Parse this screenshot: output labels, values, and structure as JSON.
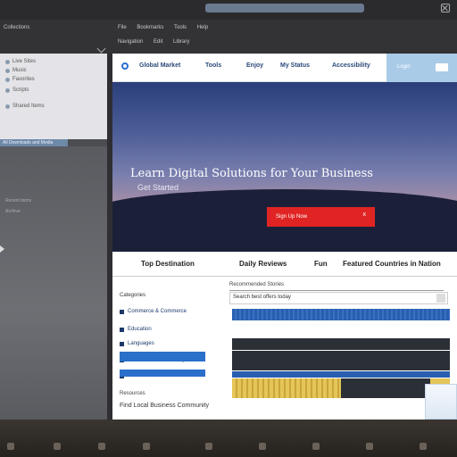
{
  "topbar": {
    "search_label": ""
  },
  "menubar": {
    "row1": [
      "File",
      "Bookmarks",
      "Tools",
      "Help"
    ],
    "row2": [
      "Navigation",
      "Edit",
      "Library"
    ],
    "left_title": "Collections"
  },
  "sidebar": {
    "items": [
      "Live Sites",
      "Music",
      "Favorites",
      "Scripts",
      "Shared Items"
    ],
    "selected": "All Downloads and Media",
    "lower_items": [
      "Recent items",
      "Archive"
    ]
  },
  "nav": {
    "links": [
      "Global Market",
      "Tools",
      "Enjoy",
      "My Status",
      "Accessibility"
    ],
    "cta_label": "Login"
  },
  "hero": {
    "title": "Learn Digital Solutions for Your Business",
    "subtitle": "Get Started",
    "button_label": "Sign Up Now",
    "button_close": "x"
  },
  "tabs": [
    "Top Destination",
    "Daily Reviews",
    "Fun",
    "Featured Countries in Nation"
  ],
  "content": {
    "section_title": "Recommended Stories",
    "column_head": "Categories",
    "search_value": "Search best offers today",
    "rows": [
      "Commerce & Commerce",
      "Education",
      "Languages",
      "Business and Marketing",
      "Parks & Trails"
    ],
    "footer_head": "Resources",
    "footer_link": "Find Local Business Community"
  },
  "colors": {
    "accent": "#2a6fd1",
    "cta": "#e02424",
    "bar_dark": "#2b2f36",
    "bar_blue": "#2a5fb0",
    "bar_yellow": "#e4c557"
  }
}
